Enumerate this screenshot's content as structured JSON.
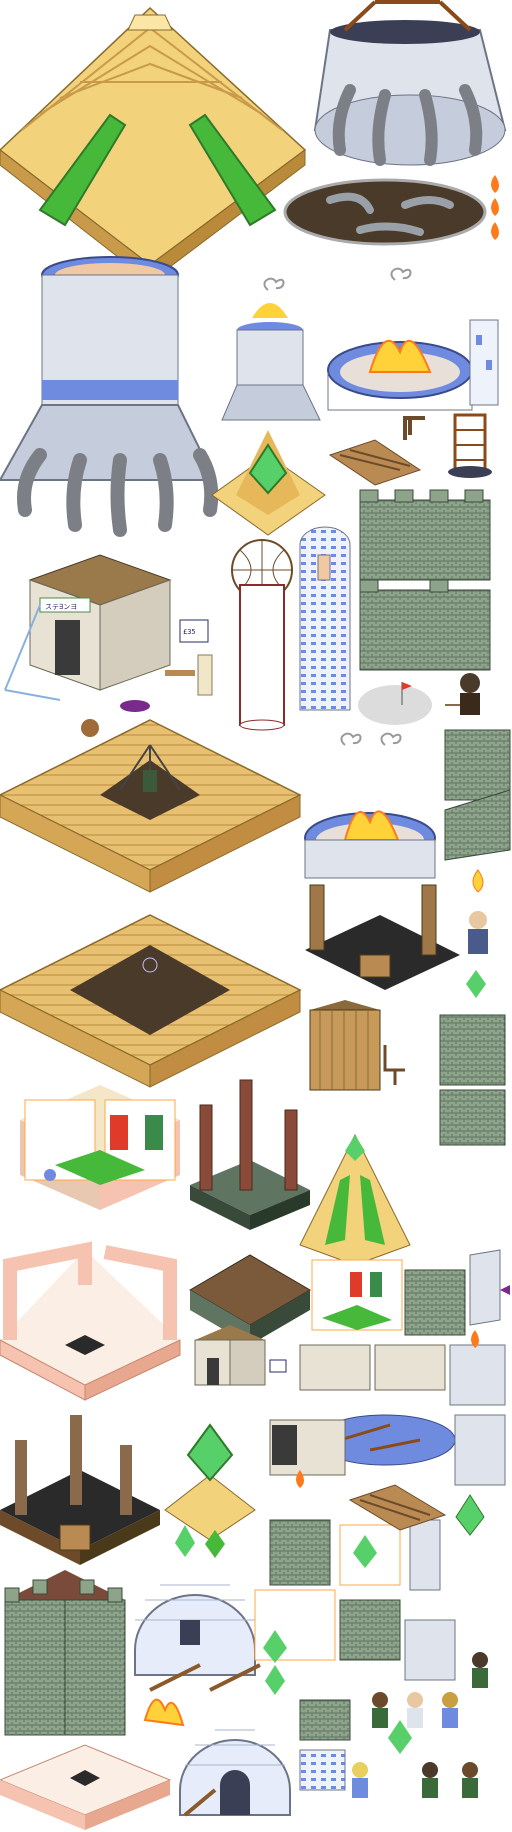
{
  "sheet": {
    "background": "#ffffff",
    "palette": {
      "sand_light": "#f2d27a",
      "sand_mid": "#e6b85a",
      "sand_dark": "#b98a3a",
      "grass": "#46b83a",
      "grass_dark": "#2f7a2a",
      "stone_light": "#dfe3ec",
      "stone_mid": "#b9c0cf",
      "stone_dark": "#6d7486",
      "pipe": "#7c7f86",
      "water": "#f0c8a4",
      "ring_blue": "#6f8be0",
      "fire_yellow": "#ffd23a",
      "fire_orange": "#ff7a1a",
      "brick_green": "#8da48a",
      "brick_dark": "#5f7561",
      "wood_light": "#b98b52",
      "wood_dark": "#6d4a2a",
      "crystal": "#58d06a",
      "igloo": "#e6ecfa",
      "pink_wall": "#f6c3b0"
    },
    "signs": {
      "temple_sign": "ステ∃ンヨ",
      "post_sign": "£35"
    },
    "sprites": [
      "pyramid-large",
      "brazier-large",
      "fire-pit",
      "flame-small",
      "tower-reactor",
      "brazier-small",
      "fire-bowl",
      "pillar-tower",
      "crystal-shrine",
      "dock",
      "gallows",
      "scaffold",
      "castle-wall",
      "stone-temple",
      "silo-tower",
      "character-warrior",
      "platform-large",
      "steps",
      "ruins-wood",
      "outhouse",
      "interior-room",
      "wood-pillars",
      "igloo",
      "castle-tower"
    ]
  }
}
